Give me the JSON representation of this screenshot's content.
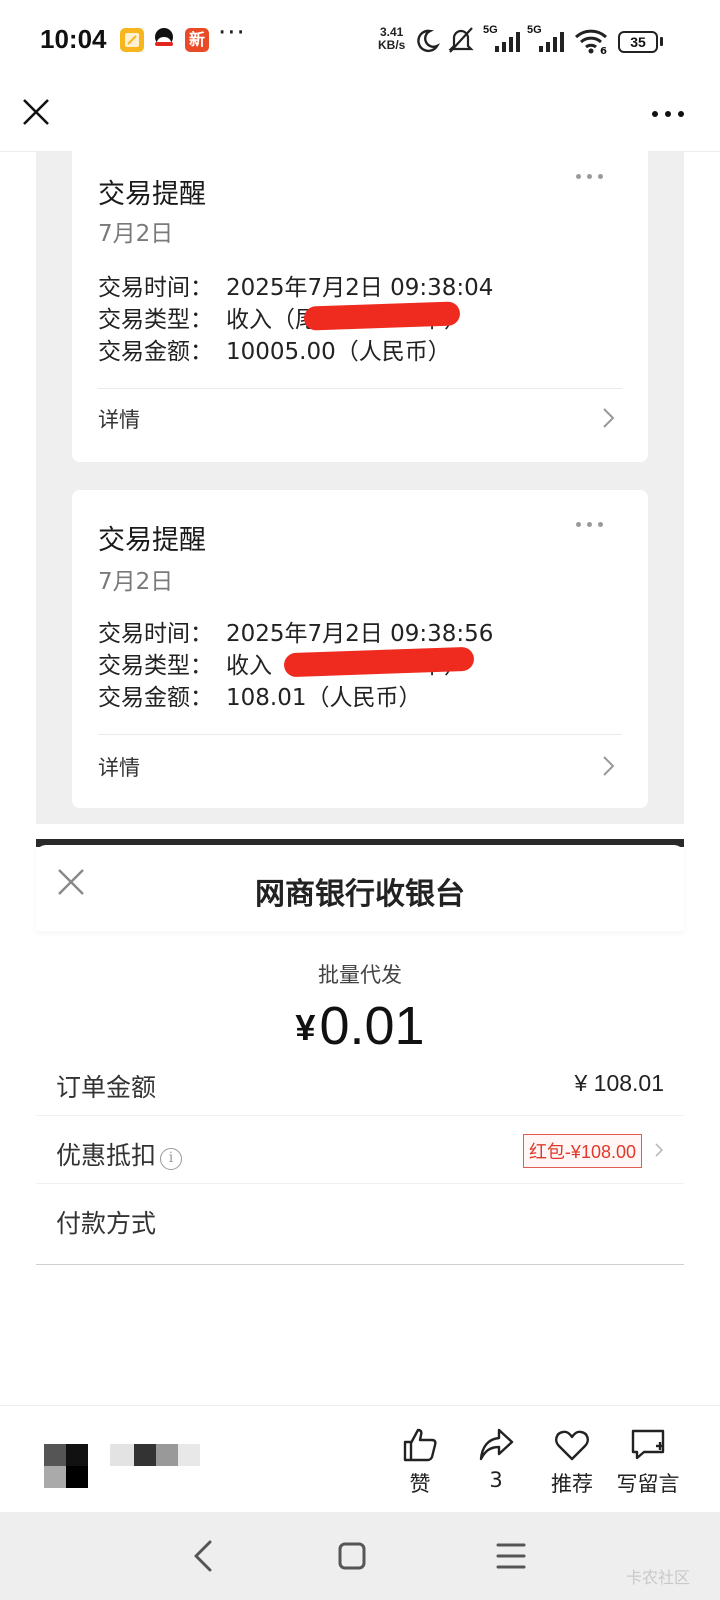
{
  "status_bar": {
    "time": "10:04",
    "app_badge_text": "新",
    "more": "···",
    "speed_value": "3.41",
    "speed_unit": "KB/s",
    "signal_1": "5G",
    "signal_2": "5G",
    "wifi_sub": "6",
    "battery": "35"
  },
  "top_bar": {
    "close_icon": "close-icon",
    "more_icon": "more-icon"
  },
  "notifications": [
    {
      "title": "交易提醒",
      "date": "7月2日",
      "time_label": "交易时间：",
      "time_value": "2025年7月2日 09:38:04",
      "type_label": "交易类型：",
      "type_value_start": "收入（尾号",
      "type_value_end": "卡）",
      "amount_label": "交易金额：",
      "amount_value": "10005.00（人民币）",
      "detail": "详情"
    },
    {
      "title": "交易提醒",
      "date": "7月2日",
      "time_label": "交易时间：",
      "time_value": "2025年7月2日 09:38:56",
      "type_label": "交易类型：",
      "type_value_start": "收入（尾号",
      "type_value_end": "卡）",
      "amount_label": "交易金额：",
      "amount_value": "108.01（人民币）",
      "detail": "详情"
    }
  ],
  "cashier": {
    "title": "网商银行收银台",
    "subtitle": "批量代发",
    "currency": "¥",
    "pay_amount": "0.01",
    "order_label": "订单金额",
    "order_value": "¥ 108.01",
    "discount_label": "优惠抵扣",
    "discount_value": "红包-¥108.00",
    "payment_label": "付款方式"
  },
  "actions": {
    "like": "赞",
    "share_count": "3",
    "recommend": "推荐",
    "comment": "写留言"
  },
  "watermark": "卡农社区",
  "colors": {
    "redaction": "#ef2a1e",
    "coupon": "#e0392b",
    "card_bg": "#efefef"
  }
}
